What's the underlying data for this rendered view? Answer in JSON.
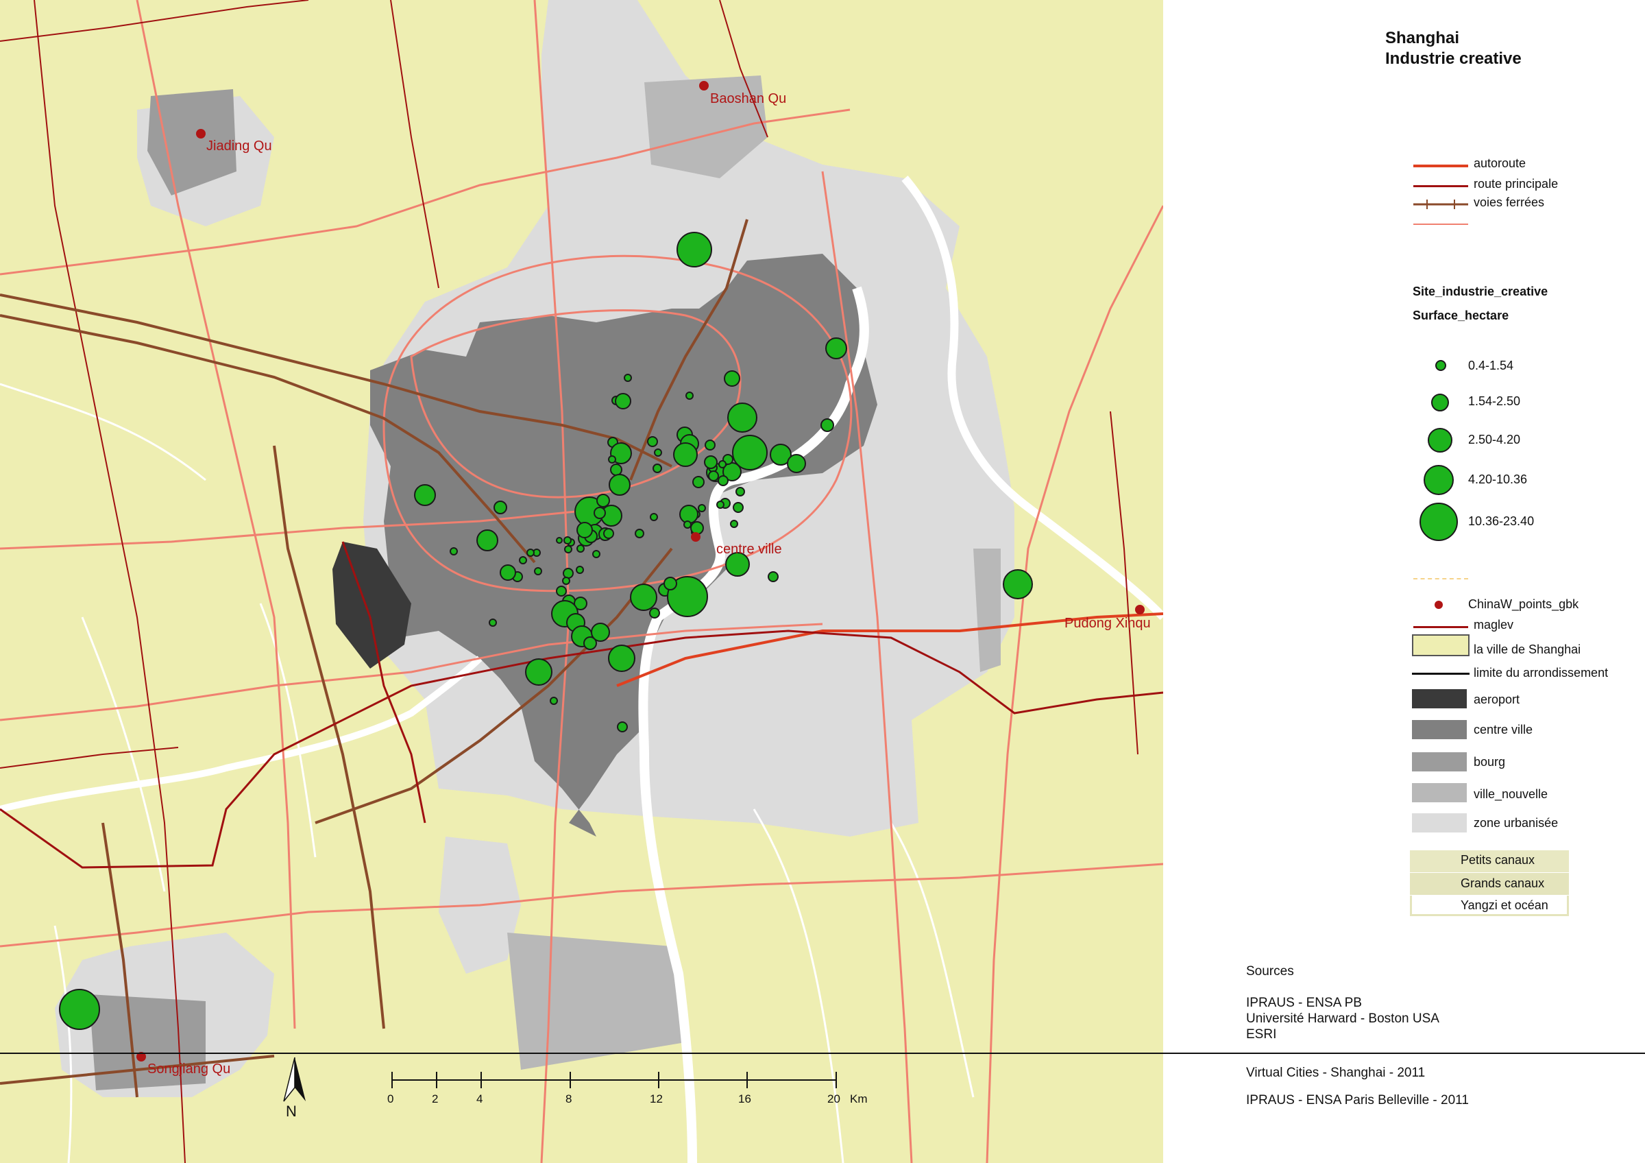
{
  "title": [
    "Shanghai",
    "Industrie creative"
  ],
  "places": [
    {
      "name": "Baoshan Qu"
    },
    {
      "name": "Jiading Qu"
    },
    {
      "name": "centre ville"
    },
    {
      "name": "Pudong Xinqu"
    },
    {
      "name": "Songjiang Qu"
    }
  ],
  "legend": {
    "roads": [
      {
        "label": "autoroute",
        "color": "#e04020"
      },
      {
        "label": "route principale",
        "color": "#a01010"
      },
      {
        "label": "voies ferrées",
        "color": "#8a4a2a"
      },
      {
        "label": "",
        "color": "#f08070"
      }
    ],
    "sites_header": "Site_industrie_creative",
    "surface_header": "Surface_hectare",
    "classes": [
      "0.4-1.54",
      "1.54-2.50",
      "2.50-4.20",
      "4.20-10.36",
      "10.36-23.40"
    ],
    "points_label": "ChinaW_points_gbk",
    "maglev_label": "maglev",
    "areas": [
      {
        "label": "la ville de Shanghai",
        "color": "#eeeeb2"
      },
      {
        "label": "limite du arrondissement",
        "color": "#111111"
      },
      {
        "label": "aeroport",
        "color": "#3a3a3a"
      },
      {
        "label": "centre ville",
        "color": "#808080"
      },
      {
        "label": "bourg",
        "color": "#9c9c9c"
      },
      {
        "label": "ville_nouvelle",
        "color": "#b8b8b8"
      },
      {
        "label": "zone urbanisée",
        "color": "#dcdcdc"
      }
    ],
    "water": [
      "Petits canaux",
      "Grands canaux",
      "Yangzi et océan"
    ]
  },
  "sources": {
    "heading": "Sources",
    "lines": [
      "IPRAUS - ENSA PB",
      "Université Harward - Boston USA",
      "ESRI"
    ],
    "credits": [
      "Virtual Cities - Shanghai - 2011",
      "IPRAUS - ENSA Paris Belleville - 2011"
    ]
  },
  "scale": {
    "ticks": [
      "0",
      "2",
      "4",
      "8",
      "12",
      "16",
      "20"
    ],
    "unit": "Km"
  },
  "north": "N",
  "colors": {
    "site_fill": "#1db31d",
    "place_dot": "#b01515",
    "land": "#eeeeb2"
  }
}
